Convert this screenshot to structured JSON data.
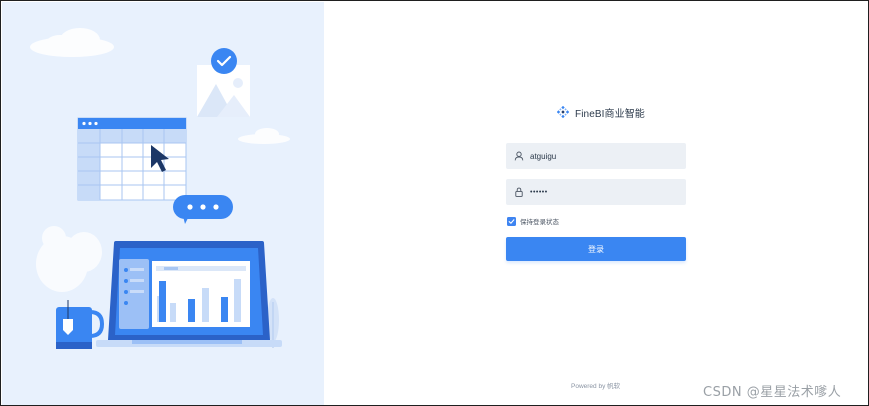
{
  "brand": {
    "name": "FineBI商业智能"
  },
  "login": {
    "username_value": "atguigu",
    "password_value": "••••••",
    "keep_logged_in_label": "保持登录状态",
    "keep_logged_in_checked": true,
    "submit_label": "登录"
  },
  "footer": {
    "powered_by": "Powered by 帆软"
  },
  "watermark": {
    "text": "CSDN @星星法术嗲人"
  },
  "icons": {
    "brand": "finebi-logo-icon",
    "username": "user-icon",
    "password": "lock-icon",
    "checkbox": "check-icon"
  },
  "colors": {
    "accent": "#3a86f2",
    "panel_bg": "#e8f1fd",
    "field_bg": "#ecf0f5"
  }
}
